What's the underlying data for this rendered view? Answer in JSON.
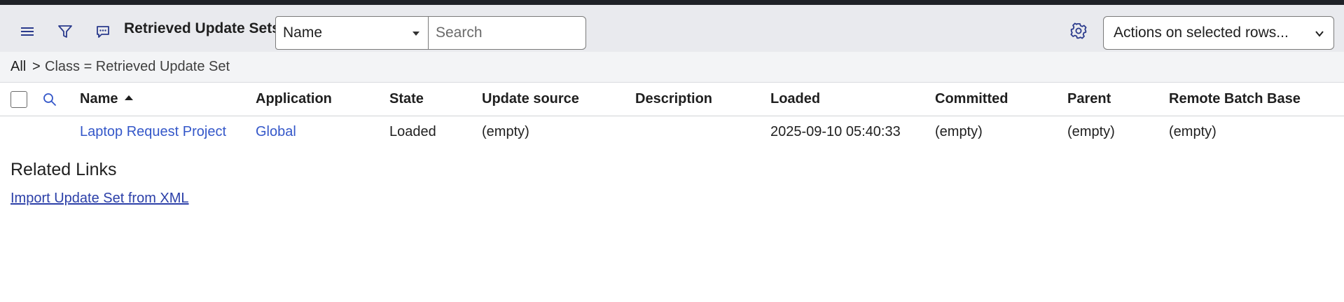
{
  "toolbar": {
    "menu_icon": "hamburger-menu-icon",
    "filter_icon": "funnel-filter-icon",
    "chat_icon": "comment-bubble-icon",
    "title": "Retrieved Update Sets",
    "search_field_select": "Name",
    "search_placeholder": "Search",
    "settings_icon": "gear-icon",
    "actions_label": "Actions on selected rows..."
  },
  "breadcrumb": {
    "all": "All",
    "separator": ">",
    "condition": "Class = Retrieved Update Set"
  },
  "table": {
    "columns": [
      "Name",
      "Application",
      "State",
      "Update source",
      "Description",
      "Loaded",
      "Committed",
      "Parent",
      "Remote Batch Base"
    ],
    "sorted_column": "Name",
    "sort_direction": "ascending",
    "rows": [
      {
        "name": "Laptop Request Project",
        "application": "Global",
        "state": "Loaded",
        "update_source": "(empty)",
        "description": "",
        "loaded": "2025-09-10 05:40:33",
        "committed": "(empty)",
        "parent": "(empty)",
        "remote_batch_base": "(empty)"
      }
    ]
  },
  "related_links": {
    "title": "Related Links",
    "links": [
      "Import Update Set from XML"
    ]
  },
  "colors": {
    "toolbar_bg": "#e9eaee",
    "breadcrumb_bg": "#f3f4f6",
    "link": "#3457c9",
    "related_link": "#2b3fa8"
  }
}
